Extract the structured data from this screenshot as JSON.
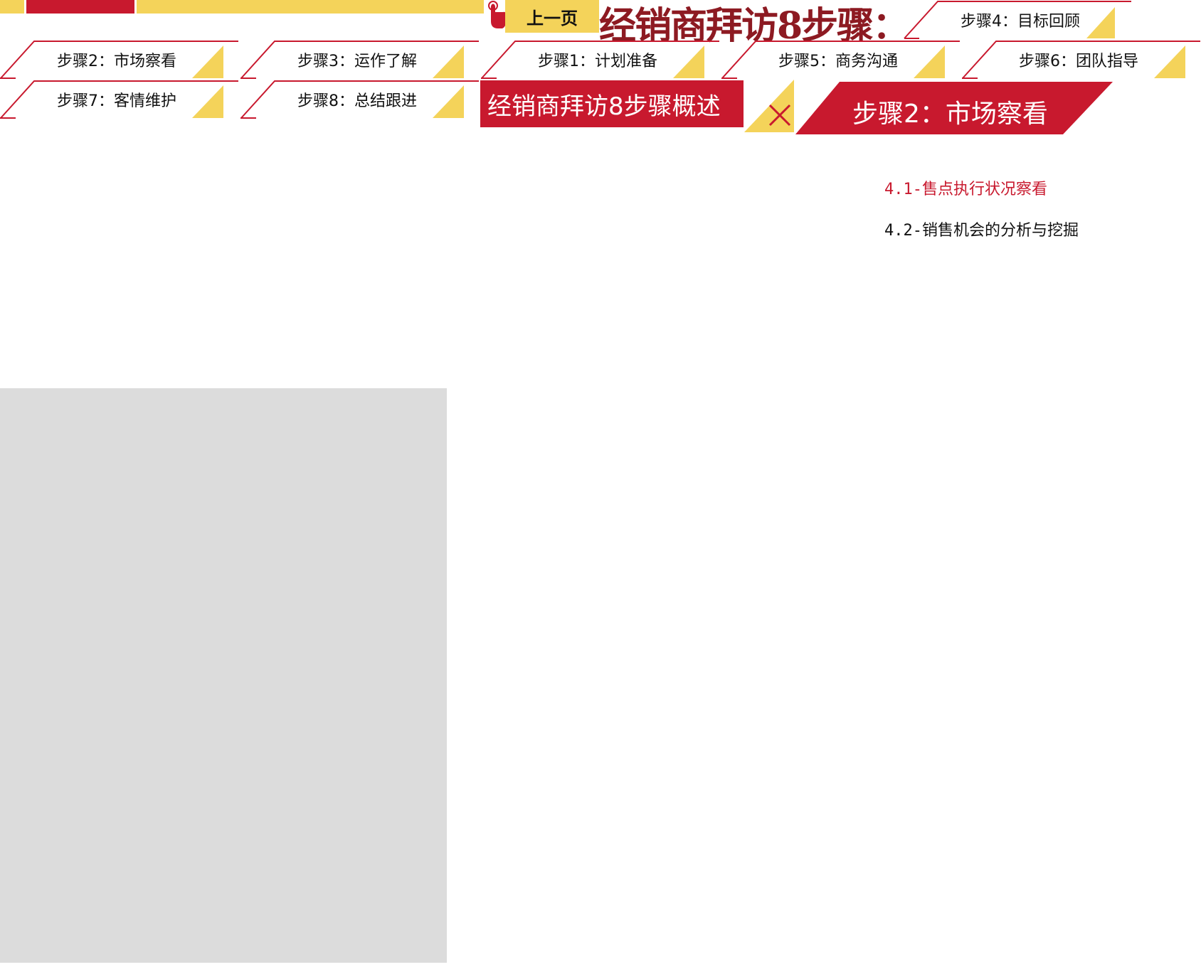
{
  "nav": {
    "prev_label": "上一页",
    "title": "经销商拜访8步骤："
  },
  "steps": {
    "step4": "步骤4：目标回顾",
    "step2": "步骤2：市场察看",
    "step3": "步骤3：运作了解",
    "step1": "步骤1：计划准备",
    "step5": "步骤5：商务沟通",
    "step6": "步骤6：团队指导",
    "step7": "步骤7：客情维护",
    "step8": "步骤8：总结跟进"
  },
  "overview_label": "经销商拜访8步骤概述",
  "current_step_label": "步骤2：市场察看",
  "sub_items": [
    {
      "label": "4.1-售点执行状况察看",
      "active": true
    },
    {
      "label": "4.2-销售机会的分析与挖掘",
      "active": false
    }
  ],
  "colors": {
    "red": "#c8192e",
    "dark_red": "#8d1a22",
    "yellow": "#f4d35a",
    "placeholder_gray": "#dcdcdc"
  },
  "icons": {
    "prev": "hand-pointer-icon",
    "close": "close-icon"
  }
}
